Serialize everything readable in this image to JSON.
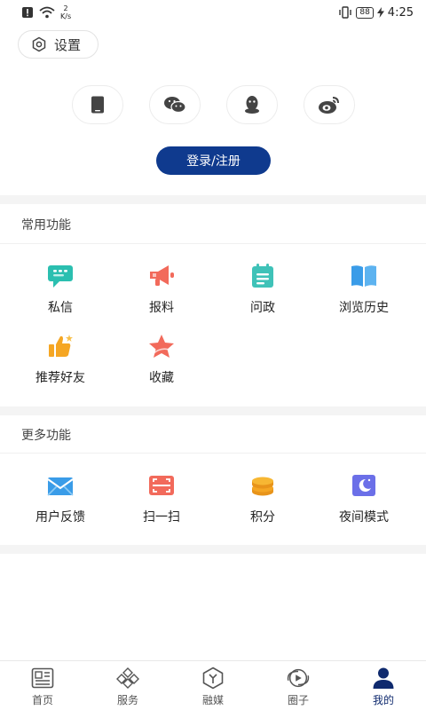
{
  "status_bar": {
    "net_speed_value": "2",
    "net_speed_unit": "K/s",
    "battery": "88",
    "time": "4:25"
  },
  "settings": {
    "label": "设置"
  },
  "social_logins": [
    {
      "icon": "phone-icon"
    },
    {
      "icon": "wechat-icon"
    },
    {
      "icon": "qq-icon"
    },
    {
      "icon": "weibo-icon"
    }
  ],
  "login_button": {
    "label": "登录/注册"
  },
  "common_functions": {
    "title": "常用功能",
    "items": [
      {
        "label": "私信",
        "icon": "message-icon",
        "color": "#2bbfb0"
      },
      {
        "label": "报料",
        "icon": "megaphone-icon",
        "color": "#f26a5b"
      },
      {
        "label": "问政",
        "icon": "notepad-icon",
        "color": "#3fc2b8"
      },
      {
        "label": "浏览历史",
        "icon": "book-icon",
        "color": "#3a9ce8"
      },
      {
        "label": "推荐好友",
        "icon": "thumbs-up-icon",
        "color": "#f5a623"
      },
      {
        "label": "收藏",
        "icon": "star-icon",
        "color": "#f26a5b"
      }
    ]
  },
  "more_functions": {
    "title": "更多功能",
    "items": [
      {
        "label": "用户反馈",
        "icon": "mail-icon",
        "color": "#3a9ce8"
      },
      {
        "label": "扫一扫",
        "icon": "scan-icon",
        "color": "#f26a5b"
      },
      {
        "label": "积分",
        "icon": "coins-icon",
        "color": "#f5a623"
      },
      {
        "label": "夜间模式",
        "icon": "moon-icon",
        "color": "#6b6fe8"
      }
    ]
  },
  "bottom_nav": [
    {
      "label": "首页",
      "icon": "news-icon",
      "active": false
    },
    {
      "label": "服务",
      "icon": "services-icon",
      "active": false
    },
    {
      "label": "融媒",
      "icon": "media-icon",
      "active": false
    },
    {
      "label": "圈子",
      "icon": "circle-icon",
      "active": false
    },
    {
      "label": "我的",
      "icon": "profile-icon",
      "active": true
    }
  ],
  "colors": {
    "primary": "#0f3a8e",
    "nav_active": "#0f2a6e"
  }
}
